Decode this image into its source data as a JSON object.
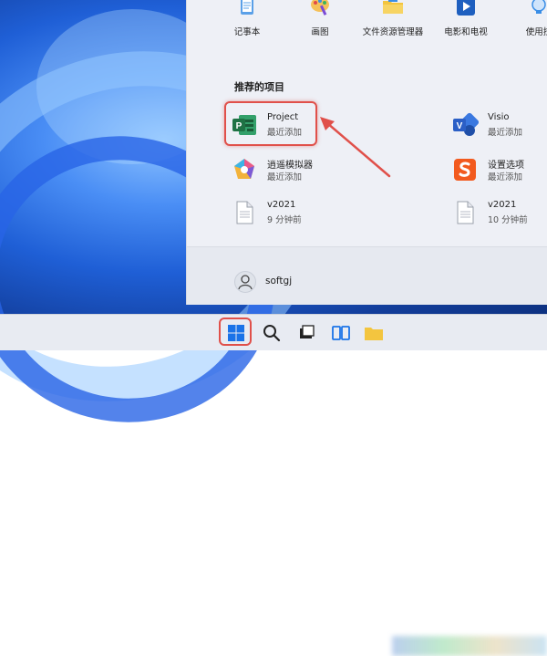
{
  "pinned_apps": [
    {
      "label": "记事本",
      "icon": "notepad-icon"
    },
    {
      "label": "画图",
      "icon": "paint-icon"
    },
    {
      "label": "文件资源管理器",
      "icon": "folder-icon"
    },
    {
      "label": "电影和电视",
      "icon": "movies-tv-icon"
    },
    {
      "label": "使用技",
      "icon": "tips-icon"
    }
  ],
  "recommended": {
    "title": "推荐的项目",
    "items": [
      {
        "name": "Project",
        "sub": "最近添加",
        "icon": "project-icon"
      },
      {
        "name": "Visio",
        "sub": "最近添加",
        "icon": "visio-icon"
      },
      {
        "name": "逍遥模拟器",
        "sub": "最近添加",
        "icon": "emulator-icon"
      },
      {
        "name": "设置选项",
        "sub": "最近添加",
        "icon": "settings-s-icon"
      },
      {
        "name": "v2021",
        "sub": "9 分钟前",
        "icon": "document-icon"
      },
      {
        "name": "v2021",
        "sub": "10 分钟前",
        "icon": "document-icon"
      }
    ]
  },
  "user": {
    "name": "softgj"
  },
  "colors": {
    "highlight": "#e0504a",
    "project_green": "#1f7244",
    "visio_blue": "#2b5fc6"
  }
}
